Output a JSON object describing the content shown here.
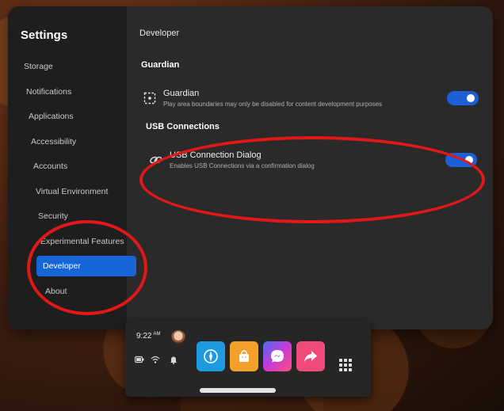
{
  "sidebar": {
    "title": "Settings",
    "items": [
      {
        "label": "Storage"
      },
      {
        "label": "Notifications"
      },
      {
        "label": "Applications"
      },
      {
        "label": "Accessibility"
      },
      {
        "label": "Accounts"
      },
      {
        "label": "Virtual Environment"
      },
      {
        "label": "Security"
      },
      {
        "label": "Experimental Features"
      },
      {
        "label": "Developer"
      },
      {
        "label": "About"
      }
    ],
    "active": "Developer"
  },
  "main": {
    "breadcrumb": "Developer",
    "sections": [
      {
        "title": "Guardian",
        "settings": [
          {
            "label": "Guardian",
            "description": "Play area boundaries may only be disabled for content development purposes",
            "icon": "dashed-boundary-icon",
            "enabled": true
          }
        ]
      },
      {
        "title": "USB Connections",
        "settings": [
          {
            "label": "USB Connection Dialog",
            "description": "Enables USB Connections via a confirmation dialog",
            "icon": "link-icon",
            "enabled": true
          }
        ]
      }
    ]
  },
  "taskbar": {
    "time": "9:22",
    "ampm": "AM",
    "apps": [
      {
        "name": "explore",
        "color": "#1e9be0"
      },
      {
        "name": "store",
        "color": "#f3a12a"
      },
      {
        "name": "messenger",
        "color": "#b437e0"
      },
      {
        "name": "share",
        "color": "#ee4b7a"
      }
    ]
  },
  "colors": {
    "accent": "#1565d8",
    "toggle_on": "#1d5fd6",
    "annotation": "#e01818"
  }
}
